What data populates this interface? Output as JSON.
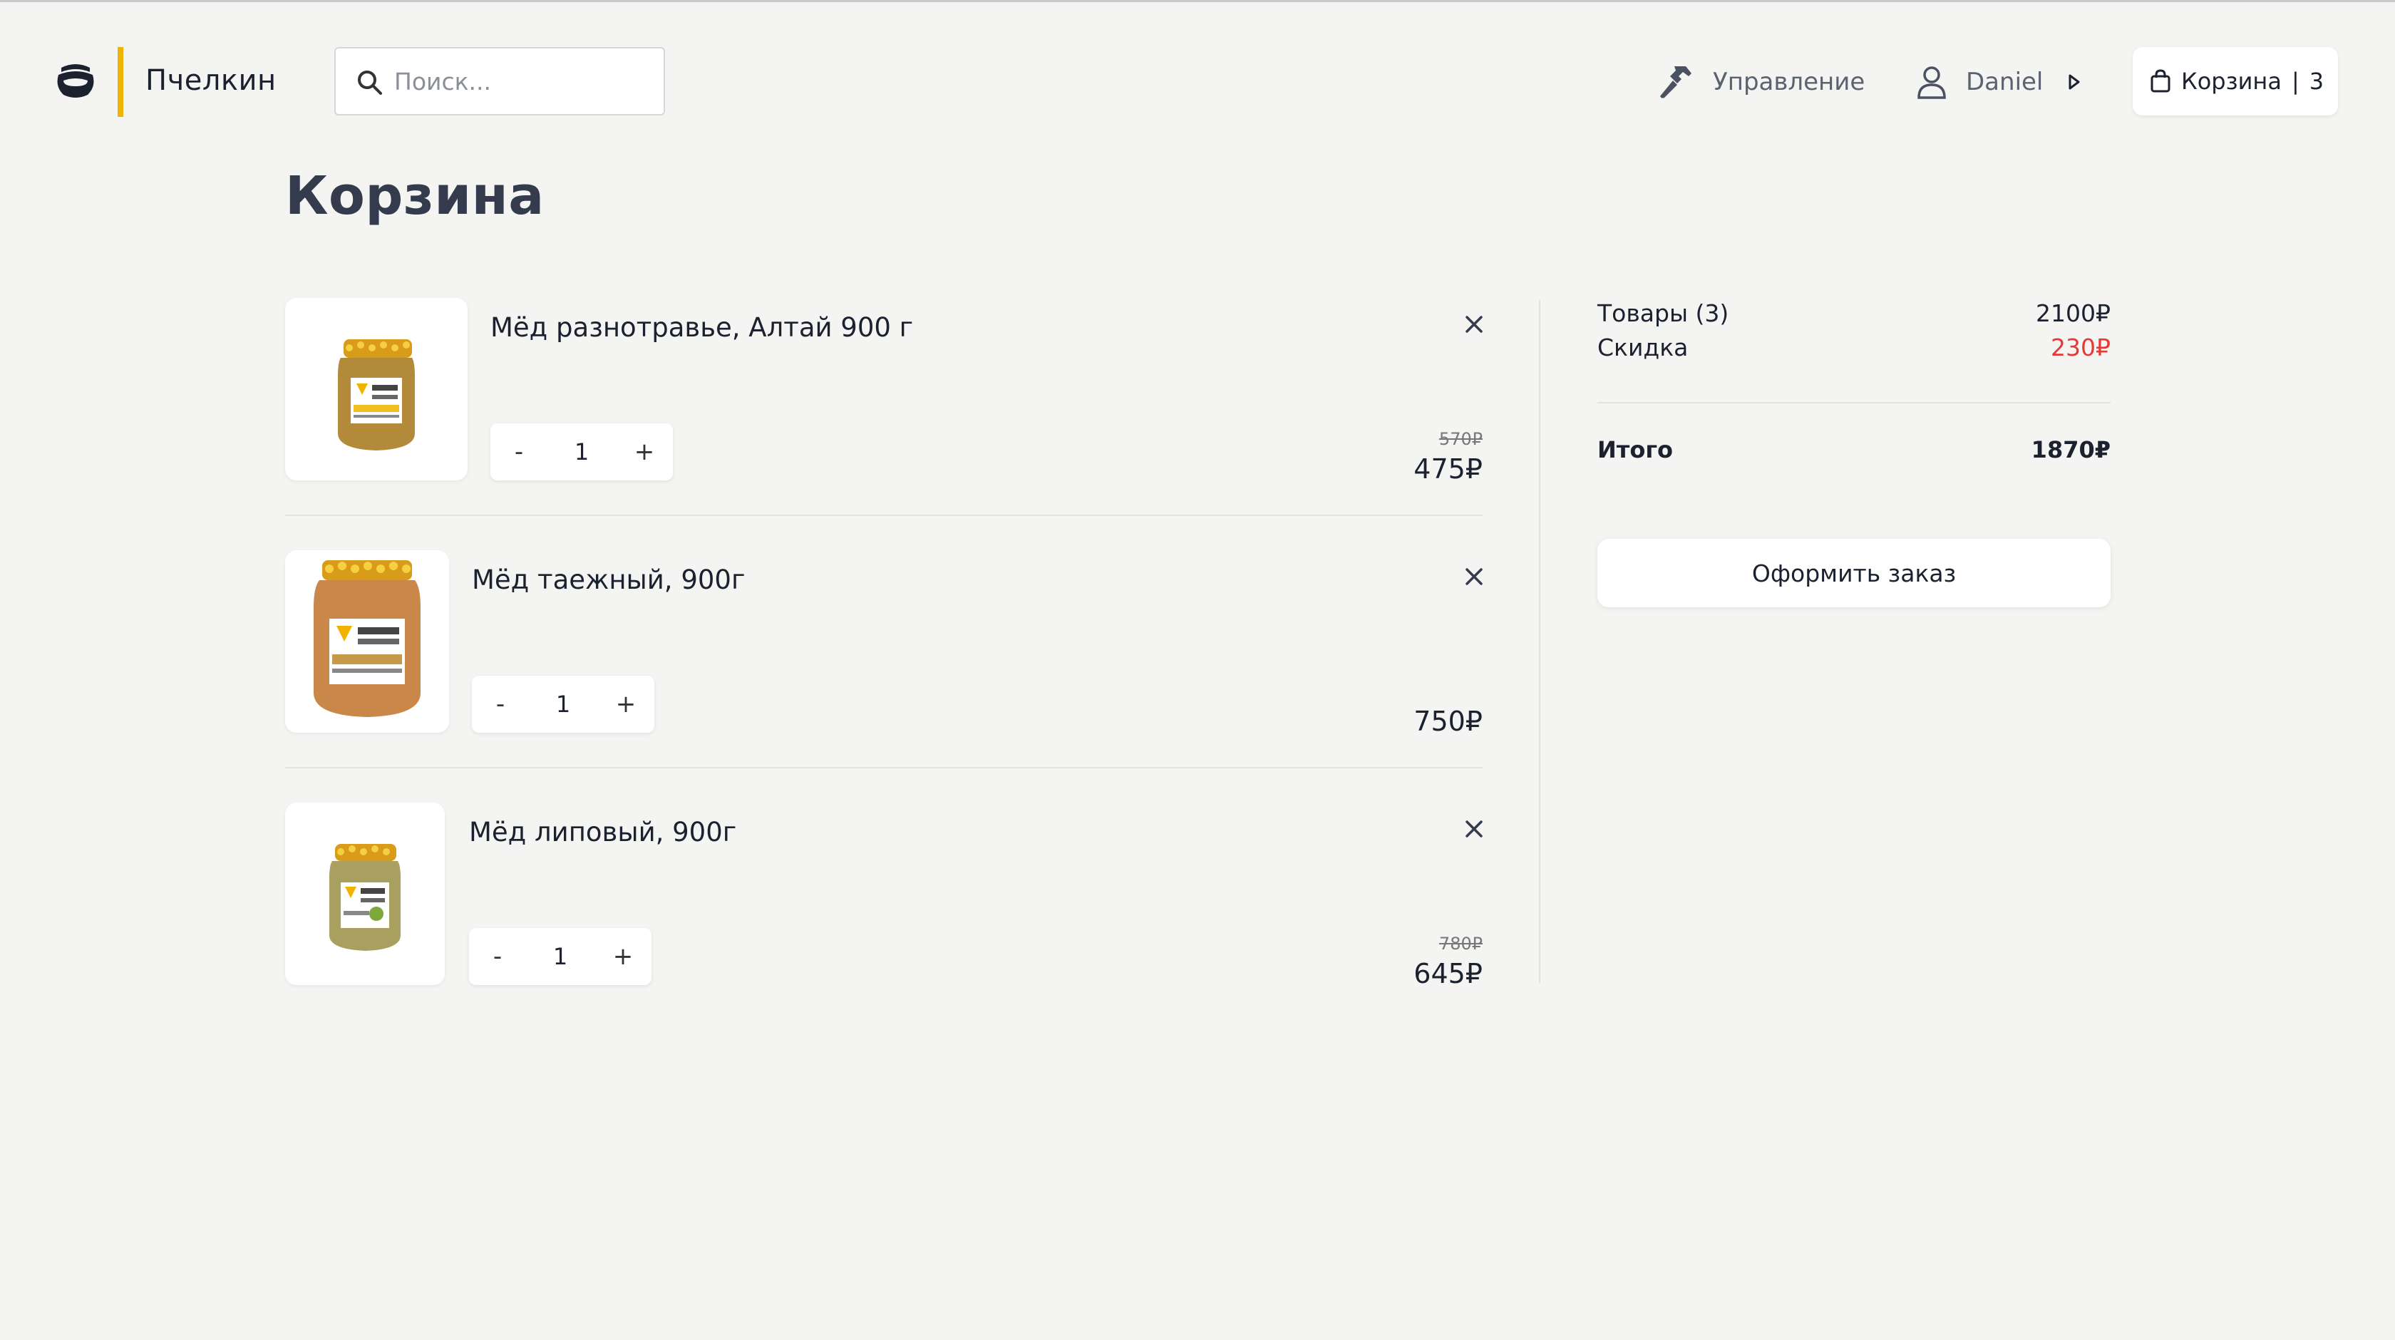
{
  "header": {
    "brand": "Пчелкин",
    "search_placeholder": "Поиск...",
    "admin_label": "Управление",
    "user_name": "Daniel",
    "cart_label": "Корзина",
    "cart_separator": "|",
    "cart_count": "3"
  },
  "page": {
    "title": "Корзина"
  },
  "cart_items": [
    {
      "name": "Мёд разнотравье, Алтай 900 г",
      "qty": "1",
      "old_price": "570₽",
      "price": "475₽"
    },
    {
      "name": "Мёд таежный, 900г",
      "qty": "1",
      "old_price": "",
      "price": "750₽"
    },
    {
      "name": "Мёд липовый, 900г",
      "qty": "1",
      "old_price": "780₽",
      "price": "645₽"
    }
  ],
  "qty_controls": {
    "minus": "-",
    "plus": "+"
  },
  "summary": {
    "items_label": "Товары (3)",
    "items_value": "2100₽",
    "discount_label": "Скидка",
    "discount_value": "230₽",
    "total_label": "Итого",
    "total_value": "1870₽",
    "checkout_label": "Оформить заказ"
  },
  "colors": {
    "background": "#f4f4f2",
    "brand_accent": "#f0b400",
    "discount": "#e53935",
    "title": "#333b4d"
  },
  "icons": [
    "honey-pot-icon",
    "search-icon",
    "hammer-icon",
    "user-icon",
    "caret-right-icon",
    "shopping-bag-icon",
    "close-icon"
  ]
}
